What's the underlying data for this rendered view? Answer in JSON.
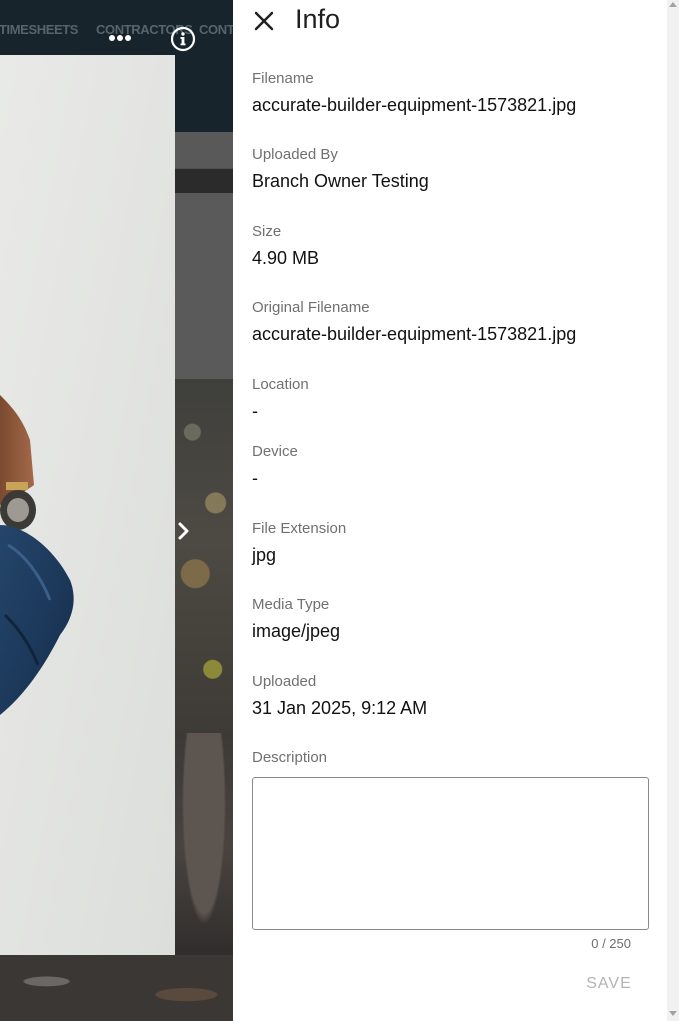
{
  "background_page": {
    "nav_tabs": [
      "TIMESHEETS",
      "CONTRACTORS",
      "CONT"
    ]
  },
  "viewer": {
    "more_icon": "more-horizontal-icon",
    "info_icon": "info-circle-icon",
    "next_icon": "chevron-right-icon"
  },
  "drawer": {
    "title": "Info",
    "close_icon": "close-icon",
    "fields": [
      {
        "label": "Filename",
        "value": "accurate-builder-equipment-1573821.jpg"
      },
      {
        "label": "Uploaded By",
        "value": "Branch Owner Testing"
      },
      {
        "label": "Size",
        "value": "4.90 MB"
      },
      {
        "label": "Original Filename",
        "value": "accurate-builder-equipment-1573821.jpg"
      },
      {
        "label": "Location",
        "value": "-"
      },
      {
        "label": "Device",
        "value": "-"
      },
      {
        "label": "File Extension",
        "value": "jpg"
      },
      {
        "label": "Media Type",
        "value": "image/jpeg"
      },
      {
        "label": "Uploaded",
        "value": "31 Jan 2025, 9:12 AM"
      }
    ],
    "description": {
      "label": "Description",
      "value": "",
      "counter": "0 / 250"
    },
    "save_label": "SAVE"
  },
  "colors": {
    "nav_background": "#17242c",
    "nav_tab_text": "#56646c",
    "label_text": "#707070",
    "value_text": "#111111",
    "save_disabled": "#b3b3b3"
  }
}
